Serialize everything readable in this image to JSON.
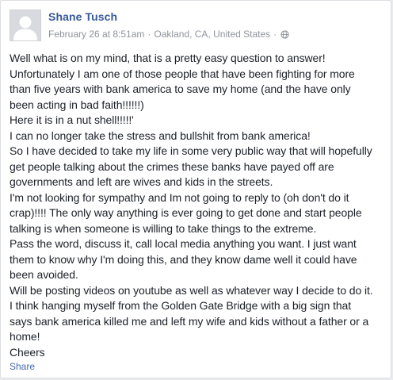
{
  "post": {
    "author": "Shane Tusch",
    "date": "February 26 at 8:51am",
    "separator": "·",
    "location": "Oakland, CA, United States",
    "audience_icon": "globe-icon",
    "lines": [
      "Well what is on my mind, that is a pretty easy question to answer!",
      "Unfortunately I am one of those people that have been fighting for more",
      "than five years with bank america to save my home (and the have only",
      "been acting in bad faith!!!!!!)",
      "Here it is in a nut shell!!!!!'",
      "I can no longer take the stress and bullshit from bank america!",
      "So I have decided to take my life in some very public way that will hopefully",
      "get people talking about the crimes these banks have payed off are",
      "governments and left are wives and kids in the streets.",
      "I'm not looking for sympathy and Im not going to reply to (oh don't do it",
      "crap)!!!! The only way anything is ever going to get done and start people",
      "talking is when someone is willing to take things to the extreme.",
      "Pass the word, discuss it, call local media anything you want. I just want",
      "them to know why I'm doing this, and they know dame well it could have",
      "been avoided.",
      "Will be posting videos on youtube as well as whatever way I decide to do it.",
      "I think hanging myself from the Golden Gate Bridge with a big sign that",
      "says bank america killed me and left my wife and kids without a father or a",
      "home!",
      "Cheers"
    ],
    "share_label": "Share"
  },
  "colors": {
    "author_link": "#365899",
    "meta_text": "#90949c",
    "body_text": "#1d2129",
    "share_link": "#4267b2",
    "card_border": "#dddfe2",
    "avatar_bg": "#d8dadf"
  }
}
